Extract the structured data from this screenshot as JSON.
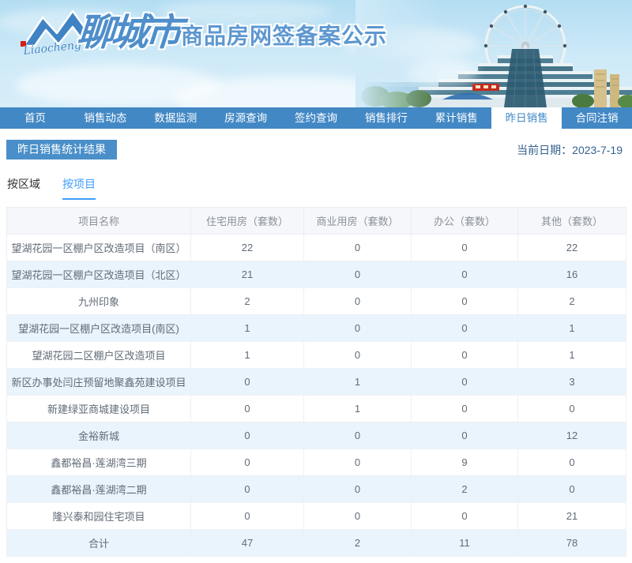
{
  "banner": {
    "logo_script": "Liaocheng",
    "city": "聊城市",
    "title": "商品房网签备案公示",
    "accent_blue": "#4288c5"
  },
  "nav": {
    "items": [
      {
        "label": "首页",
        "active": false
      },
      {
        "label": "销售动态",
        "active": false
      },
      {
        "label": "数据监测",
        "active": false
      },
      {
        "label": "房源查询",
        "active": false
      },
      {
        "label": "签约查询",
        "active": false
      },
      {
        "label": "销售排行",
        "active": false
      },
      {
        "label": "累计销售",
        "active": false
      },
      {
        "label": "昨日销售",
        "active": true
      },
      {
        "label": "合同注销",
        "active": false
      }
    ]
  },
  "page": {
    "section_title": "昨日销售统计结果",
    "date_label": "当前日期：",
    "date_value": "2023-7-19"
  },
  "tabs": [
    {
      "label": "按区域",
      "active": false
    },
    {
      "label": "按项目",
      "active": true
    }
  ],
  "table": {
    "columns": [
      "项目名称",
      "住宅用房（套数）",
      "商业用房（套数）",
      "办公（套数）",
      "其他（套数）"
    ],
    "rows": [
      [
        "望湖花园一区棚户区改造项目（南区）",
        "22",
        "0",
        "0",
        "22"
      ],
      [
        "望湖花园一区棚户区改造项目（北区）",
        "21",
        "0",
        "0",
        "16"
      ],
      [
        "九州印象",
        "2",
        "0",
        "0",
        "2"
      ],
      [
        "望湖花园一区棚户区改造项目(南区)",
        "1",
        "0",
        "0",
        "1"
      ],
      [
        "望湖花园二区棚户区改造项目",
        "1",
        "0",
        "0",
        "1"
      ],
      [
        "新区办事处闫庄预留地聚鑫苑建设项目",
        "0",
        "1",
        "0",
        "3"
      ],
      [
        "新建绿亚商城建设项目",
        "0",
        "1",
        "0",
        "0"
      ],
      [
        "金裕新城",
        "0",
        "0",
        "0",
        "12"
      ],
      [
        "鑫都裕昌·莲湖湾三期",
        "0",
        "0",
        "9",
        "0"
      ],
      [
        "鑫都裕昌·莲湖湾二期",
        "0",
        "0",
        "2",
        "0"
      ],
      [
        "隆兴泰和园住宅项目",
        "0",
        "0",
        "0",
        "21"
      ],
      [
        "合计",
        "47",
        "2",
        "11",
        "78"
      ]
    ],
    "total_row_label": "合计"
  }
}
